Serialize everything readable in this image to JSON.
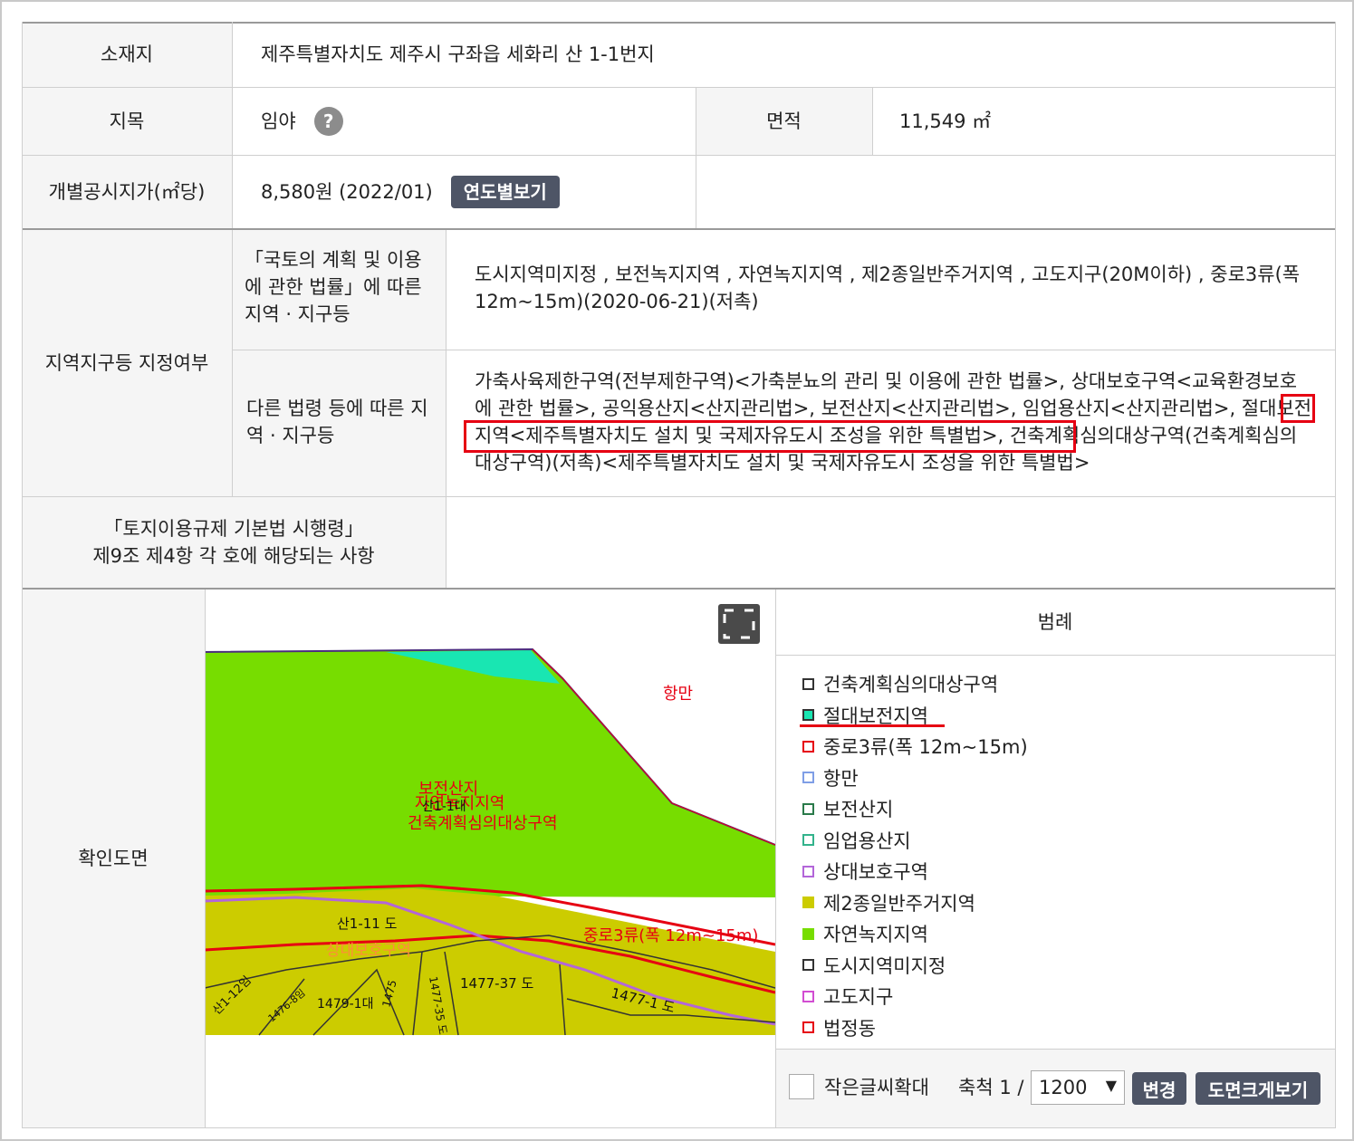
{
  "location": {
    "label": "소재지",
    "value": "제주특별자치도 제주시 구좌읍 세화리 산 1-1번지"
  },
  "land_category": {
    "label": "지목",
    "value": "임야",
    "help_icon": "question-icon"
  },
  "area": {
    "label": "면적",
    "value": "11,549 ㎡"
  },
  "official_price": {
    "label": "개별공시지가(㎡당)",
    "value": "8,580원 (2022/01)",
    "button": "연도별보기"
  },
  "zoning": {
    "label": "지역지구등 지정여부",
    "national_label": "「국토의 계획 및 이용에 관한 법률」에 따른 지역 · 지구등",
    "national_value": "도시지역미지정 , 보전녹지지역 , 자연녹지지역 , 제2종일반주거지역 , 고도지구(20M이하) , 중로3류(폭 12m~15m)(2020-06-21)(저촉)",
    "other_label": "다른 법령 등에 따른 지역 · 지구등",
    "other_value": "가축사육제한구역(전부제한구역)<가축분뇨의 관리 및 이용에 관한 법률>, 상대보호구역<교육환경보호에 관한 법률>, 공익용산지<산지관리법>, 보전산지<산지관리법>, 임업용산지<산지관리법>, 절대보전지역<제주특별자치도 설치 및 국제자유도시 조성을 위한 특별법>, 건축계획심의대상구역(건축계획심의대상구역)(저촉)<제주특별자치도 설치 및 국제자유도시 조성을 위한 특별법>"
  },
  "enforcement": {
    "label_line1": "「토지이용규제 기본법 시행령」",
    "label_line2": "제9조 제4항 각 호에 해당되는 사항",
    "value": ""
  },
  "map": {
    "label": "확인도면",
    "fullscreen_icon": "fullscreen-icon",
    "labels": {
      "hangman": "항만",
      "boj": "보전산지",
      "nature": "자연녹지지역",
      "lot_main": "산1-1대",
      "review": "건축계획심의대상구역",
      "lot_road": "산1-11 도",
      "road3": "중로3류(폭 12m~15m)",
      "protect": "상대보호구역",
      "lot_a": "산1-12임",
      "lot_b": "1479-1대",
      "lot_c": "1477-37 도",
      "lot_d": "1477-1 도",
      "lot_e": "1477-35 도",
      "lot_f": "1475",
      "lot_g": "1476-8임"
    },
    "colors": {
      "green": "#77dd00",
      "teal": "#19e6b2",
      "yellow": "#cccc00"
    }
  },
  "legend": {
    "title": "범례",
    "items": [
      {
        "label": "건축계획심의대상구역",
        "border": "#333333",
        "fill": "#ffffff"
      },
      {
        "label": "절대보전지역",
        "border": "#333333",
        "fill": "#19e6b2"
      },
      {
        "label": "중로3류(폭 12m~15m)",
        "border": "#e60012",
        "fill": "#ffffff"
      },
      {
        "label": "항만",
        "border": "#7f9ee6",
        "fill": "#ffffff"
      },
      {
        "label": "보전산지",
        "border": "#2a7a4a",
        "fill": "#ffffff"
      },
      {
        "label": "임업용산지",
        "border": "#33b38c",
        "fill": "#ffffff"
      },
      {
        "label": "상대보호구역",
        "border": "#b366d9",
        "fill": "#ffffff"
      },
      {
        "label": "제2종일반주거지역",
        "border": "#cccc00",
        "fill": "#cccc00"
      },
      {
        "label": "자연녹지지역",
        "border": "#77dd00",
        "fill": "#77dd00"
      },
      {
        "label": "도시지역미지정",
        "border": "#333333",
        "fill": "#ffffff"
      },
      {
        "label": "고도지구",
        "border": "#d24dd2",
        "fill": "#ffffff"
      },
      {
        "label": "법정동",
        "border": "#e60012",
        "fill": "#ffffff"
      }
    ]
  },
  "controls": {
    "enlarge_label": "작은글씨확대",
    "scale_label": "축척 1 /",
    "scale_value": "1200",
    "change_button": "변경",
    "bigmap_button": "도면크게보기"
  }
}
